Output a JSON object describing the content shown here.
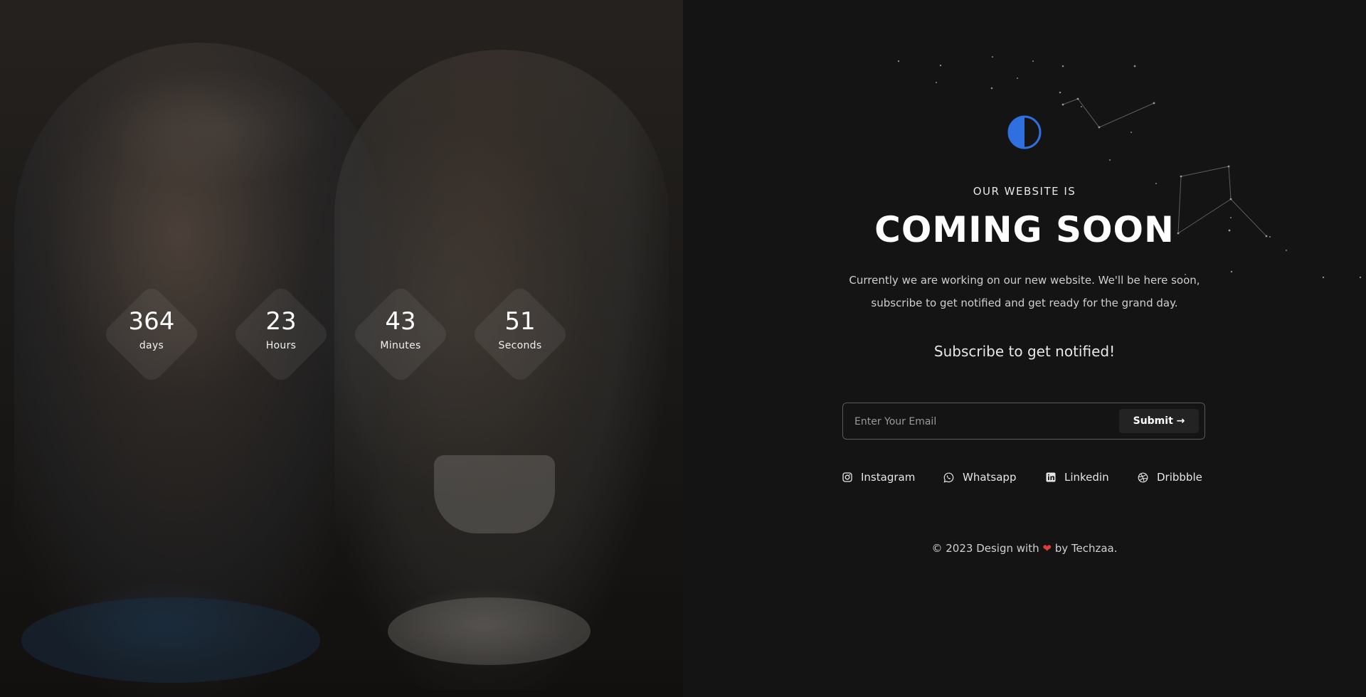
{
  "countdown": [
    {
      "value": "364",
      "label": "days"
    },
    {
      "value": "23",
      "label": "Hours"
    },
    {
      "value": "43",
      "label": "Minutes"
    },
    {
      "value": "51",
      "label": "Seconds"
    }
  ],
  "hero": {
    "eyebrow": "OUR WEBSITE IS",
    "title": "COMING SOON",
    "description": "Currently we are working on our new website. We'll be here soon, subscribe to get notified and get ready for the grand day.",
    "subscribe_heading": "Subscribe to get notified!"
  },
  "form": {
    "email_placeholder": "Enter Your Email",
    "submit_label": "Submit →"
  },
  "social": [
    {
      "label": "Instagram",
      "icon": "instagram-icon"
    },
    {
      "label": "Whatsapp",
      "icon": "whatsapp-icon"
    },
    {
      "label": "Linkedin",
      "icon": "linkedin-icon"
    },
    {
      "label": "Dribbble",
      "icon": "dribbble-icon"
    }
  ],
  "footer": {
    "prefix": "© 2023 Design with",
    "heart": "❤",
    "suffix": "by Techzaa."
  },
  "colors": {
    "accent": "#2f6fe0",
    "heart": "#e23b3b",
    "background": "#141414"
  }
}
